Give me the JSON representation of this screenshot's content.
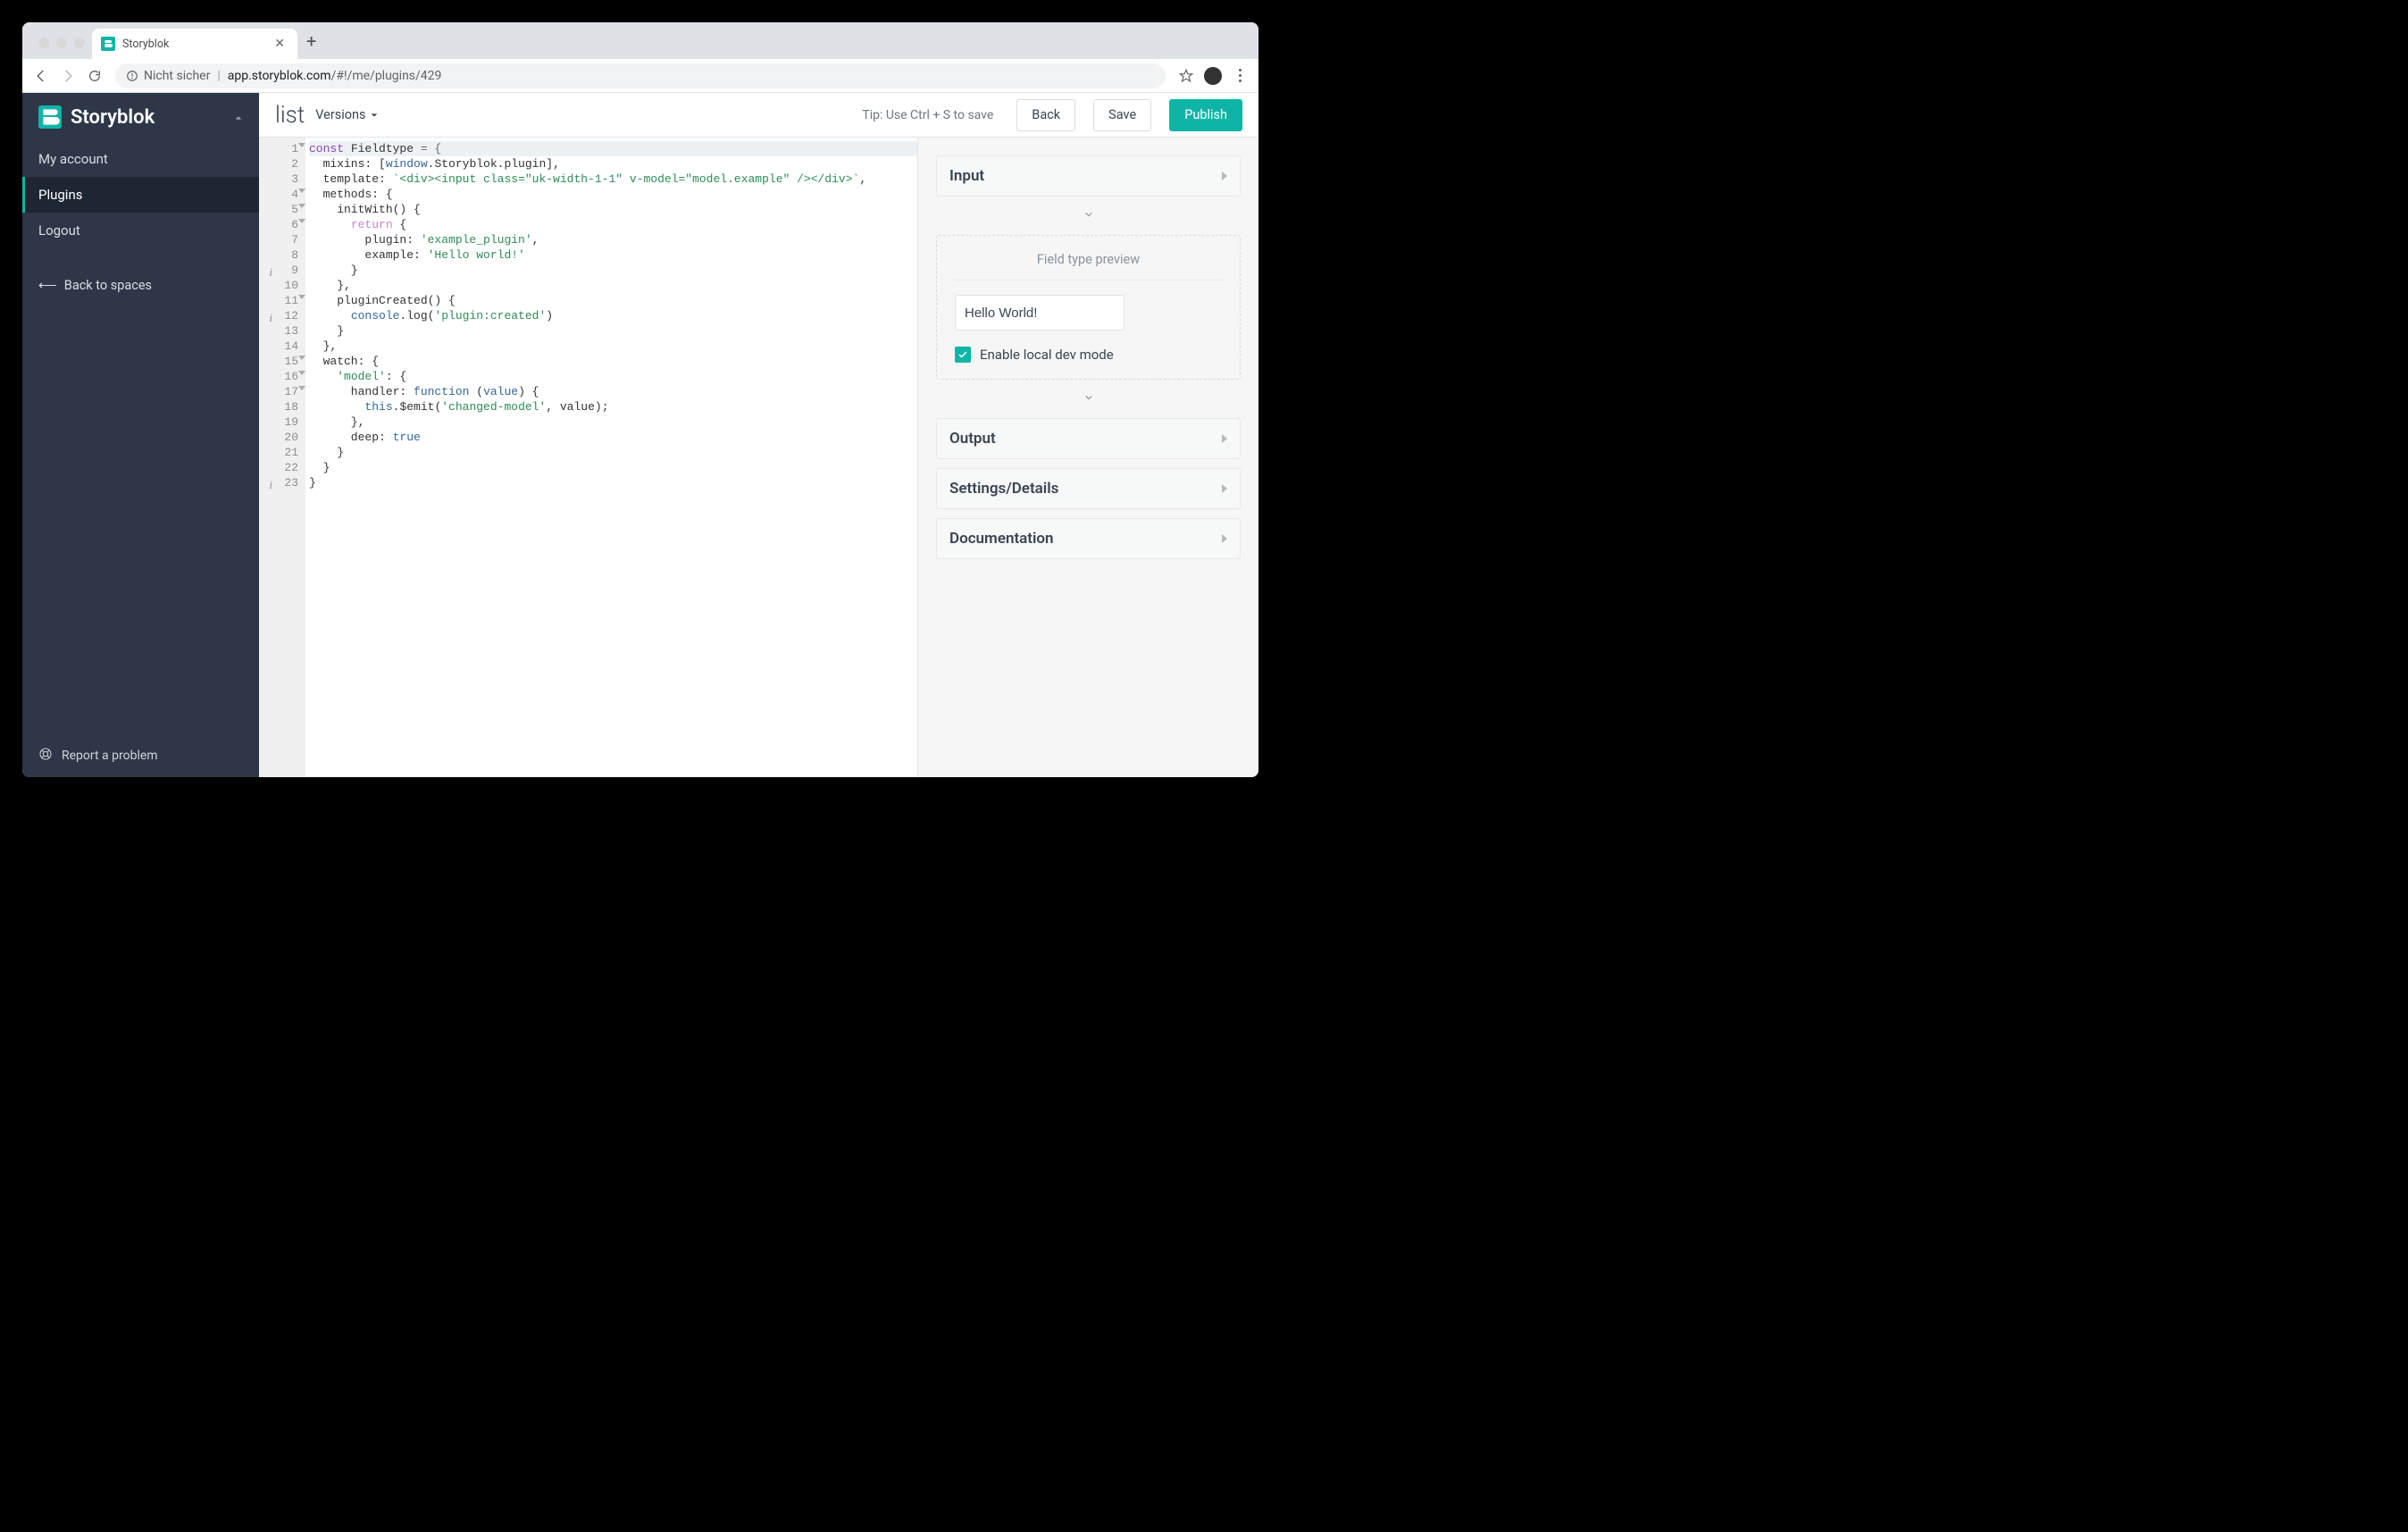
{
  "browser": {
    "tab_title": "Storyblok",
    "url_warning": "Nicht sicher",
    "url_domain": "app.storyblok.com",
    "url_path": "/#!/me/plugins/429"
  },
  "sidebar": {
    "brand": "Storyblok",
    "items": [
      {
        "label": "My account"
      },
      {
        "label": "Plugins"
      },
      {
        "label": "Logout"
      }
    ],
    "back_label": "Back to spaces",
    "footer_label": "Report a problem"
  },
  "header": {
    "title": "list",
    "versions_label": "Versions",
    "tip": "Tip: Use Ctrl + S to save",
    "buttons": {
      "back": "Back",
      "save": "Save",
      "publish": "Publish"
    }
  },
  "editor": {
    "lines": [
      {
        "n": 1,
        "fold": true,
        "tokens": [
          [
            "const ",
            "kw2"
          ],
          [
            "Fieldtype ",
            "prop"
          ],
          [
            "= {",
            "punct"
          ]
        ]
      },
      {
        "n": 2,
        "tokens": [
          [
            "  mixins: [",
            ""
          ],
          [
            "window",
            "var"
          ],
          [
            ".Storyblok.plugin],",
            ""
          ]
        ]
      },
      {
        "n": 3,
        "tokens": [
          [
            "  template: ",
            ""
          ],
          [
            "`<div><input class=\"uk-width-1-1\" v-model=\"model.example\" /></div>`",
            "str"
          ],
          [
            ",",
            ""
          ]
        ]
      },
      {
        "n": 4,
        "fold": true,
        "tokens": [
          [
            "  methods: {",
            ""
          ]
        ]
      },
      {
        "n": 5,
        "fold": true,
        "tokens": [
          [
            "    initWith() {",
            ""
          ]
        ]
      },
      {
        "n": 6,
        "fold": true,
        "tokens": [
          [
            "      ",
            ""
          ],
          [
            "return",
            "kw"
          ],
          [
            " {",
            ""
          ]
        ]
      },
      {
        "n": 7,
        "tokens": [
          [
            "        plugin: ",
            ""
          ],
          [
            "'example_plugin'",
            "str"
          ],
          [
            ",",
            ""
          ]
        ]
      },
      {
        "n": 8,
        "tokens": [
          [
            "        example: ",
            ""
          ],
          [
            "'Hello world!'",
            "str"
          ]
        ]
      },
      {
        "n": 9,
        "info": true,
        "tokens": [
          [
            "      }",
            ""
          ]
        ]
      },
      {
        "n": 10,
        "tokens": [
          [
            "    },",
            ""
          ]
        ]
      },
      {
        "n": 11,
        "fold": true,
        "tokens": [
          [
            "    pluginCreated() {",
            ""
          ]
        ]
      },
      {
        "n": 12,
        "info": true,
        "tokens": [
          [
            "      ",
            ""
          ],
          [
            "console",
            "var"
          ],
          [
            ".log(",
            ""
          ],
          [
            "'plugin:created'",
            "str"
          ],
          [
            ")",
            ""
          ]
        ]
      },
      {
        "n": 13,
        "tokens": [
          [
            "    }",
            ""
          ]
        ]
      },
      {
        "n": 14,
        "tokens": [
          [
            "  },",
            ""
          ]
        ]
      },
      {
        "n": 15,
        "fold": true,
        "tokens": [
          [
            "  watch: {",
            ""
          ]
        ]
      },
      {
        "n": 16,
        "fold": true,
        "tokens": [
          [
            "    ",
            ""
          ],
          [
            "'model'",
            "str"
          ],
          [
            ": {",
            ""
          ]
        ]
      },
      {
        "n": 17,
        "fold": true,
        "tokens": [
          [
            "      handler: ",
            ""
          ],
          [
            "function",
            "func"
          ],
          [
            " (",
            ""
          ],
          [
            "value",
            "var"
          ],
          [
            ") {",
            ""
          ]
        ]
      },
      {
        "n": 18,
        "tokens": [
          [
            "        ",
            ""
          ],
          [
            "this",
            "var"
          ],
          [
            ".$emit(",
            ""
          ],
          [
            "'changed-model'",
            "str"
          ],
          [
            ", value);",
            ""
          ]
        ]
      },
      {
        "n": 19,
        "tokens": [
          [
            "      },",
            ""
          ]
        ]
      },
      {
        "n": 20,
        "tokens": [
          [
            "      deep: ",
            ""
          ],
          [
            "true",
            "bool"
          ]
        ]
      },
      {
        "n": 21,
        "tokens": [
          [
            "    }",
            ""
          ]
        ]
      },
      {
        "n": 22,
        "tokens": [
          [
            "  }",
            ""
          ]
        ]
      },
      {
        "n": 23,
        "info": true,
        "tokens": [
          [
            "}",
            ""
          ]
        ]
      }
    ]
  },
  "right_panel": {
    "sections": {
      "input": "Input",
      "output": "Output",
      "settings": "Settings/Details",
      "documentation": "Documentation"
    },
    "preview": {
      "title": "Field type preview",
      "input_value": "Hello World!",
      "checkbox_label": "Enable local dev mode",
      "checkbox_checked": true
    }
  }
}
